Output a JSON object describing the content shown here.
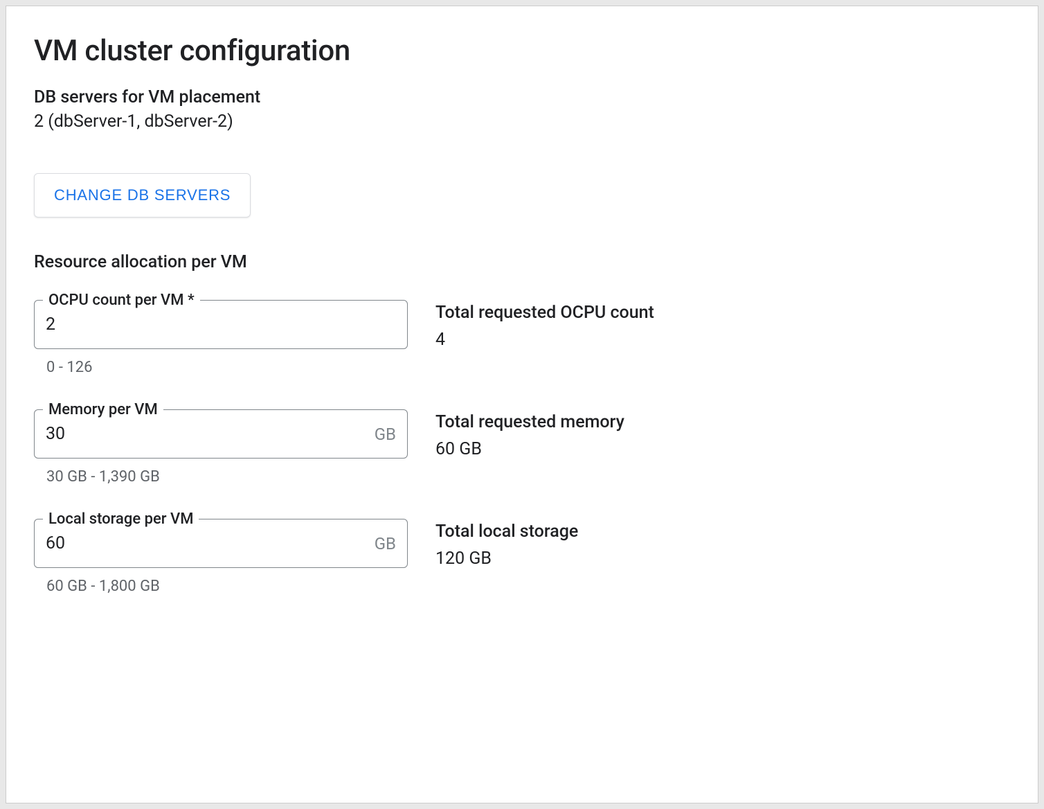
{
  "title": "VM cluster configuration",
  "dbServers": {
    "label": "DB servers for VM placement",
    "value": "2 (dbServer-1, dbServer-2)",
    "changeButton": "CHANGE DB SERVERS"
  },
  "resourceAllocation": {
    "header": "Resource allocation per VM",
    "ocpu": {
      "label": "OCPU count per VM *",
      "value": "2",
      "helper": "0 - 126",
      "totalLabel": "Total requested OCPU count",
      "totalValue": "4"
    },
    "memory": {
      "label": "Memory per VM",
      "value": "30",
      "unit": "GB",
      "helper": "30 GB - 1,390 GB",
      "totalLabel": "Total requested memory",
      "totalValue": "60 GB"
    },
    "localStorage": {
      "label": "Local storage per VM",
      "value": "60",
      "unit": "GB",
      "helper": "60 GB - 1,800 GB",
      "totalLabel": "Total local storage",
      "totalValue": "120 GB"
    }
  }
}
